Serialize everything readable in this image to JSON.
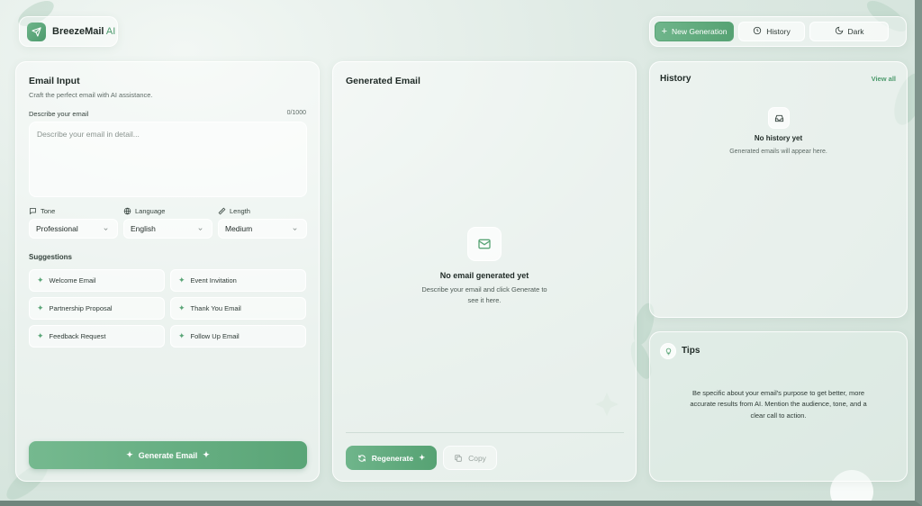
{
  "brand": {
    "name": "BreezeMail",
    "suffix": " AI",
    "logo_icon": "send-icon"
  },
  "topnav": {
    "new_generation": "New Generation",
    "history": "History",
    "dark": "Dark"
  },
  "email_input": {
    "title": "Email Input",
    "subtitle": "Craft the perfect email with AI assistance.",
    "describe_label": "Describe your email",
    "char_count": "0/1000",
    "placeholder": "Describe your email in detail...",
    "tone": {
      "label": "Tone",
      "value": "Professional"
    },
    "language": {
      "label": "Language",
      "value": "English"
    },
    "length": {
      "label": "Length",
      "value": "Medium"
    },
    "suggestions_title": "Suggestions",
    "suggestions": [
      "Welcome Email",
      "Event Invitation",
      "Partnership Proposal",
      "Thank You Email",
      "Feedback Request",
      "Follow Up Email"
    ],
    "generate_button": "Generate Email"
  },
  "generated": {
    "title": "Generated Email",
    "empty_title": "No email generated yet",
    "empty_line1": "Describe your email and click Generate to",
    "empty_line2": "see it here.",
    "regenerate": "Regenerate",
    "copy": "Copy"
  },
  "history": {
    "title": "History",
    "view_all": "View all",
    "empty_title": "No history yet",
    "empty_subtitle": "Generated emails will appear here."
  },
  "tips": {
    "title": "Tips",
    "line1": "Be specific about your email's purpose to get better, more",
    "line2": "accurate results from AI. Mention the audience, tone, and a",
    "line3": "clear call to action."
  },
  "colors": {
    "accent": "#5aa577",
    "accent_light": "#6fb58b",
    "text": "#1f2a26"
  }
}
